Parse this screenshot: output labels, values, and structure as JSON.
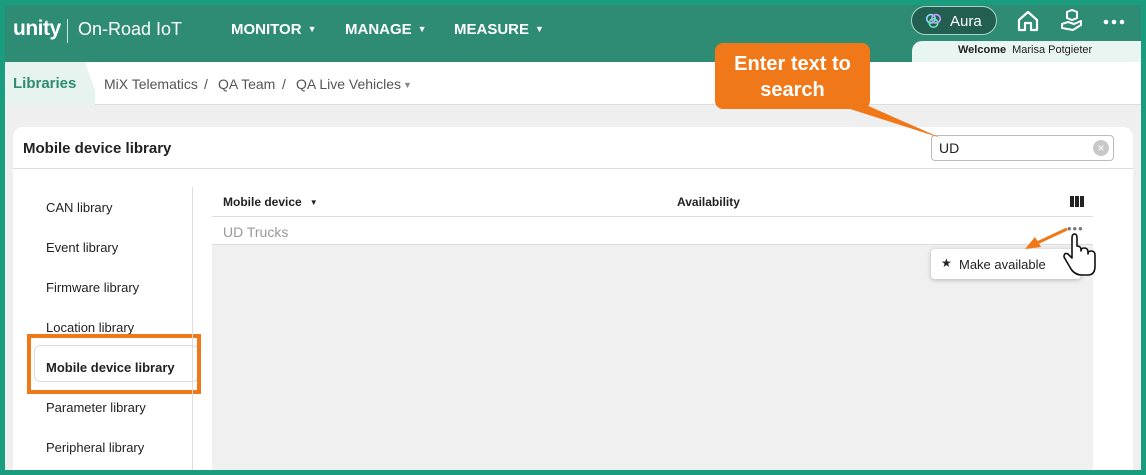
{
  "header": {
    "logo": "unity",
    "product": "On-Road IoT",
    "nav": [
      {
        "label": "MONITOR"
      },
      {
        "label": "MANAGE"
      },
      {
        "label": "MEASURE"
      }
    ],
    "aura_label": "Aura",
    "welcome_label": "Welcome",
    "user_name": "Marisa Potgieter",
    "icons": [
      "home-icon",
      "hand-box-icon",
      "more-icon"
    ]
  },
  "breadcrumb": {
    "active": "Libraries",
    "items": [
      "MiX Telematics",
      "QA Team",
      "QA Live Vehicles"
    ],
    "separator": "/"
  },
  "card": {
    "title": "Mobile device library",
    "search": {
      "value": "UD"
    }
  },
  "sidebar": {
    "items": [
      {
        "label": "CAN library"
      },
      {
        "label": "Event library"
      },
      {
        "label": "Firmware library"
      },
      {
        "label": "Location library"
      },
      {
        "label": "Mobile device library",
        "selected": true
      },
      {
        "label": "Parameter library"
      },
      {
        "label": "Peripheral library"
      }
    ]
  },
  "table": {
    "columns": [
      "Mobile device",
      "Availability"
    ],
    "rows": [
      {
        "mobile_device": "UD Trucks"
      }
    ]
  },
  "context_menu": {
    "items": [
      {
        "label": "Make available",
        "icon": "star-icon"
      }
    ]
  },
  "callout": {
    "text": "Enter text to search"
  },
  "colors": {
    "header": "#2e8b74",
    "accent": "#f07818",
    "border": "#1a9c7f"
  }
}
